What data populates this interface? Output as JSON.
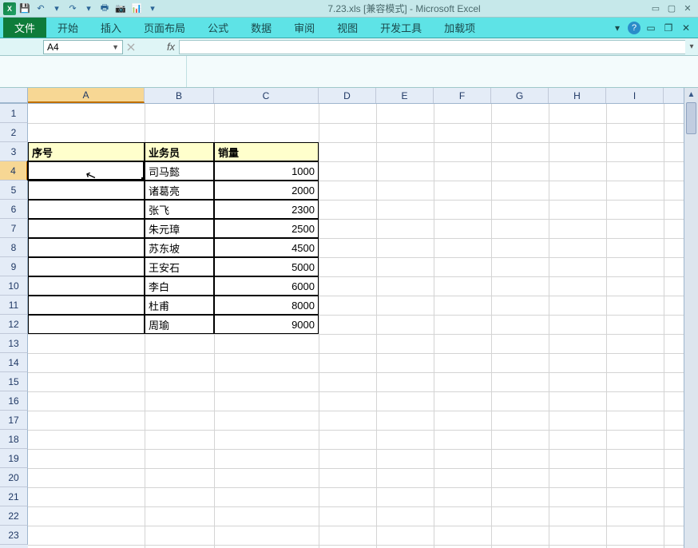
{
  "title": "7.23.xls [兼容模式] - Microsoft Excel",
  "qat": {
    "save": "💾",
    "undo": "↶",
    "redo": "↷"
  },
  "ribbon": {
    "file": "文件",
    "tabs": [
      "开始",
      "插入",
      "页面布局",
      "公式",
      "数据",
      "审阅",
      "视图",
      "开发工具",
      "加载项"
    ]
  },
  "name_box": "A4",
  "fx": "fx",
  "columns": [
    "A",
    "B",
    "C",
    "D",
    "E",
    "F",
    "G",
    "H",
    "I"
  ],
  "col_widths": {
    "A": 146,
    "B": 87,
    "C": 131,
    "default": 72
  },
  "row_count": 23,
  "active_cell": {
    "row": 4,
    "col": "A"
  },
  "table": {
    "headers": {
      "A": "序号",
      "B": "业务员",
      "C": "销量"
    },
    "header_row": 3,
    "rows": [
      {
        "A": "",
        "B": "司马懿",
        "C": 1000
      },
      {
        "A": "",
        "B": "诸葛亮",
        "C": 2000
      },
      {
        "A": "",
        "B": "张飞",
        "C": 2300
      },
      {
        "A": "",
        "B": "朱元璋",
        "C": 2500
      },
      {
        "A": "",
        "B": "苏东坡",
        "C": 4500
      },
      {
        "A": "",
        "B": "王安石",
        "C": 5000
      },
      {
        "A": "",
        "B": "李白",
        "C": 6000
      },
      {
        "A": "",
        "B": "杜甫",
        "C": 8000
      },
      {
        "A": "",
        "B": "周瑜",
        "C": 9000
      }
    ]
  }
}
